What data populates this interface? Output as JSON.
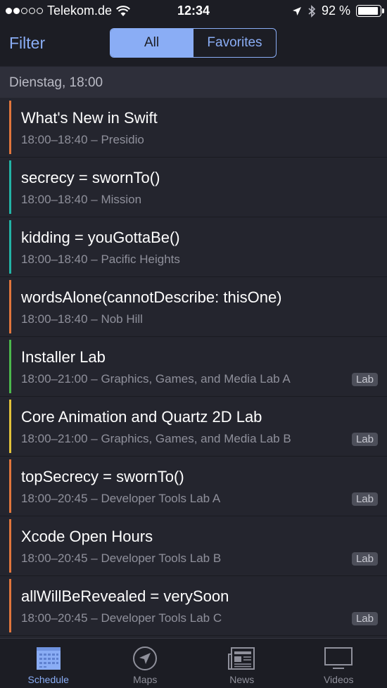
{
  "status_bar": {
    "carrier": "Telekom.de",
    "time": "12:34",
    "battery_percent": "92 %",
    "battery_level": 0.92,
    "signal_bars_on": 2,
    "signal_bars_total": 5
  },
  "nav": {
    "filter_label": "Filter",
    "segments": [
      "All",
      "Favorites"
    ],
    "selected_segment": "All"
  },
  "section": {
    "title": "Dienstag, 18:00"
  },
  "sessions": [
    {
      "title": "What's New in Swift",
      "subtitle": "18:00–18:40 – Presidio",
      "accent": "#e0763c",
      "badge": ""
    },
    {
      "title": "secrecy = swornTo()",
      "subtitle": "18:00–18:40 – Mission",
      "accent": "#23b3a6",
      "badge": ""
    },
    {
      "title": "kidding = youGottaBe()",
      "subtitle": "18:00–18:40 – Pacific Heights",
      "accent": "#23b3a6",
      "badge": ""
    },
    {
      "title": "wordsAlone(cannotDescribe: thisOne)",
      "subtitle": "18:00–18:40 – Nob Hill",
      "accent": "#e0763c",
      "badge": ""
    },
    {
      "title": "Installer Lab",
      "subtitle": "18:00–21:00 – Graphics, Games, and Media Lab A",
      "accent": "#4cb84c",
      "badge": "Lab"
    },
    {
      "title": "Core Animation and Quartz 2D Lab",
      "subtitle": "18:00–21:00 – Graphics, Games, and Media Lab B",
      "accent": "#e3c23a",
      "badge": "Lab"
    },
    {
      "title": "topSecrecy = swornTo()",
      "subtitle": "18:00–20:45 – Developer Tools Lab A",
      "accent": "#e0763c",
      "badge": "Lab"
    },
    {
      "title": "Xcode Open Hours",
      "subtitle": "18:00–20:45 – Developer Tools Lab B",
      "accent": "#e0763c",
      "badge": "Lab"
    },
    {
      "title": "allWillBeRevealed = verySoon",
      "subtitle": "18:00–20:45 – Developer Tools Lab C",
      "accent": "#e0763c",
      "badge": "Lab"
    }
  ],
  "tabs": [
    {
      "label": "Schedule",
      "icon": "calendar-icon",
      "active": true
    },
    {
      "label": "Maps",
      "icon": "compass-icon",
      "active": false
    },
    {
      "label": "News",
      "icon": "newspaper-icon",
      "active": false
    },
    {
      "label": "Videos",
      "icon": "tv-icon",
      "active": false
    }
  ],
  "colors": {
    "accent_blue": "#8aadf5",
    "background": "#24252e",
    "bar_background": "#1c1d24"
  }
}
